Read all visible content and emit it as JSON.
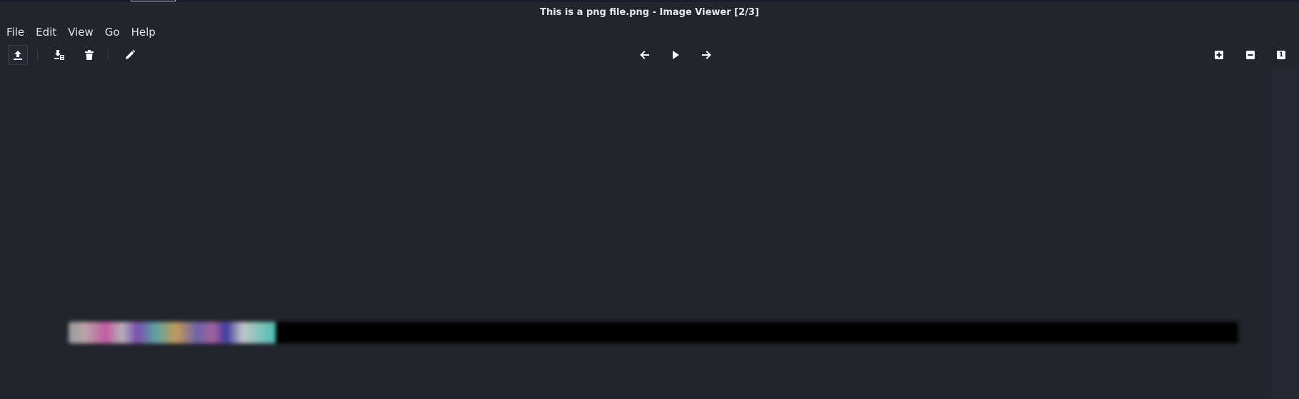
{
  "window": {
    "title": "This is a png file.png - Image Viewer [2/3]"
  },
  "menu": {
    "items": [
      "File",
      "Edit",
      "View",
      "Go",
      "Help"
    ]
  },
  "toolbar": {
    "left_icons": [
      "open-icon",
      "save-as-icon",
      "delete-icon",
      "edit-icon"
    ],
    "center_icons": [
      "previous-arrow-icon",
      "play-slideshow-icon",
      "next-arrow-icon"
    ],
    "right_icons": [
      "zoom-in-icon",
      "zoom-out-icon",
      "actual-size-icon"
    ],
    "actual_size_label": "1"
  },
  "colors": {
    "background": "#23252d",
    "title_text": "#e7e8ec",
    "icon": "#ffffff"
  }
}
